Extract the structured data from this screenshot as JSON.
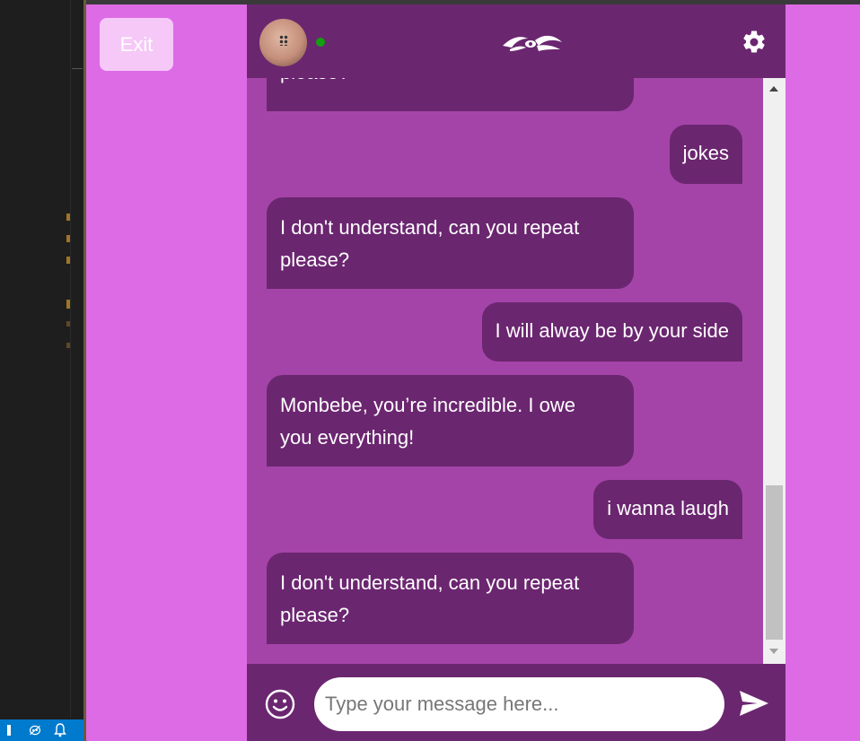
{
  "exit_label": "Exit",
  "header": {
    "online": true,
    "logo_icon": "tribal-eye-logo",
    "settings_icon": "gear-icon"
  },
  "messages": [
    {
      "sender": "bot",
      "text": "please?"
    },
    {
      "sender": "user",
      "text": "jokes"
    },
    {
      "sender": "bot",
      "lines": [
        "I don't understand, can you repeat",
        "please?"
      ]
    },
    {
      "sender": "user",
      "text": "I will alway be by your side"
    },
    {
      "sender": "bot",
      "lines": [
        "Monbebe, you’re incredible. I owe",
        "you everything!"
      ]
    },
    {
      "sender": "user",
      "text": "i wanna laugh"
    },
    {
      "sender": "bot",
      "lines": [
        "I don't understand, can you repeat",
        "please?"
      ]
    }
  ],
  "composer": {
    "placeholder": "Type your message here...",
    "emoji_icon": "smiley-icon",
    "send_icon": "send-icon"
  },
  "colors": {
    "page_bg": "#dd6be6",
    "chat_bg": "#a444a8",
    "header_bg": "#6b2670",
    "bubble_bg": "#6b2670",
    "exit_bg": "#f6c8f8",
    "online": "#10a010"
  }
}
